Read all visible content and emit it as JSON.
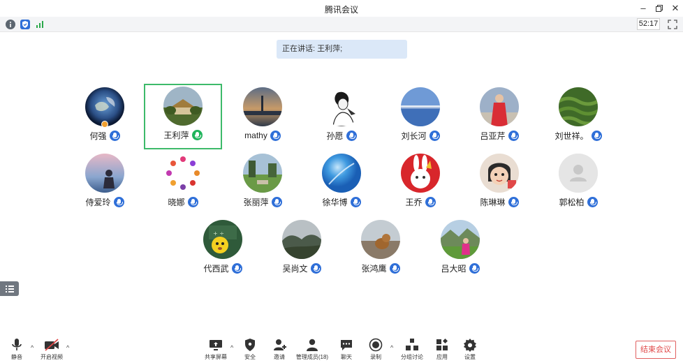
{
  "window": {
    "title": "腾讯会议"
  },
  "infobar": {
    "timer": "52:17"
  },
  "speaking": {
    "label": "正在讲话:",
    "names": "王利萍;"
  },
  "participants": [
    {
      "name": "何强",
      "mic": "blue"
    },
    {
      "name": "王利萍",
      "mic": "green"
    },
    {
      "name": "mathy",
      "mic": "blue"
    },
    {
      "name": "孙愿",
      "mic": "blue"
    },
    {
      "name": "刘长河",
      "mic": "blue"
    },
    {
      "name": "吕亚芹",
      "mic": "blue"
    },
    {
      "name": "刘世祥。",
      "mic": "blue"
    },
    {
      "name": "侍爱玲",
      "mic": "blue"
    },
    {
      "name": "晓娜",
      "mic": "blue"
    },
    {
      "name": "张丽萍",
      "mic": "blue"
    },
    {
      "name": "徐华博",
      "mic": "blue"
    },
    {
      "name": "王乔",
      "mic": "blue"
    },
    {
      "name": "陈琳琳",
      "mic": "blue"
    },
    {
      "name": "郭松柏",
      "mic": "blue"
    },
    {
      "name": "代西武",
      "mic": "blue"
    },
    {
      "name": "吴尚文",
      "mic": "blue"
    },
    {
      "name": "张鸿鹰",
      "mic": "blue"
    },
    {
      "name": "吕大昭",
      "mic": "blue"
    }
  ],
  "toolbar": {
    "mute": "静音",
    "video": "开启视频",
    "share": "共享屏幕",
    "security": "安全",
    "invite": "邀请",
    "members": "管理成员(18)",
    "chat": "聊天",
    "record": "录制",
    "breakout": "分组讨论",
    "apps": "应用",
    "settings": "设置",
    "end": "结束会议"
  },
  "colors": {
    "accent": "#2f6fd8",
    "speaking": "#20b45c",
    "active_border": "#3dba6a",
    "end": "#e04848"
  }
}
